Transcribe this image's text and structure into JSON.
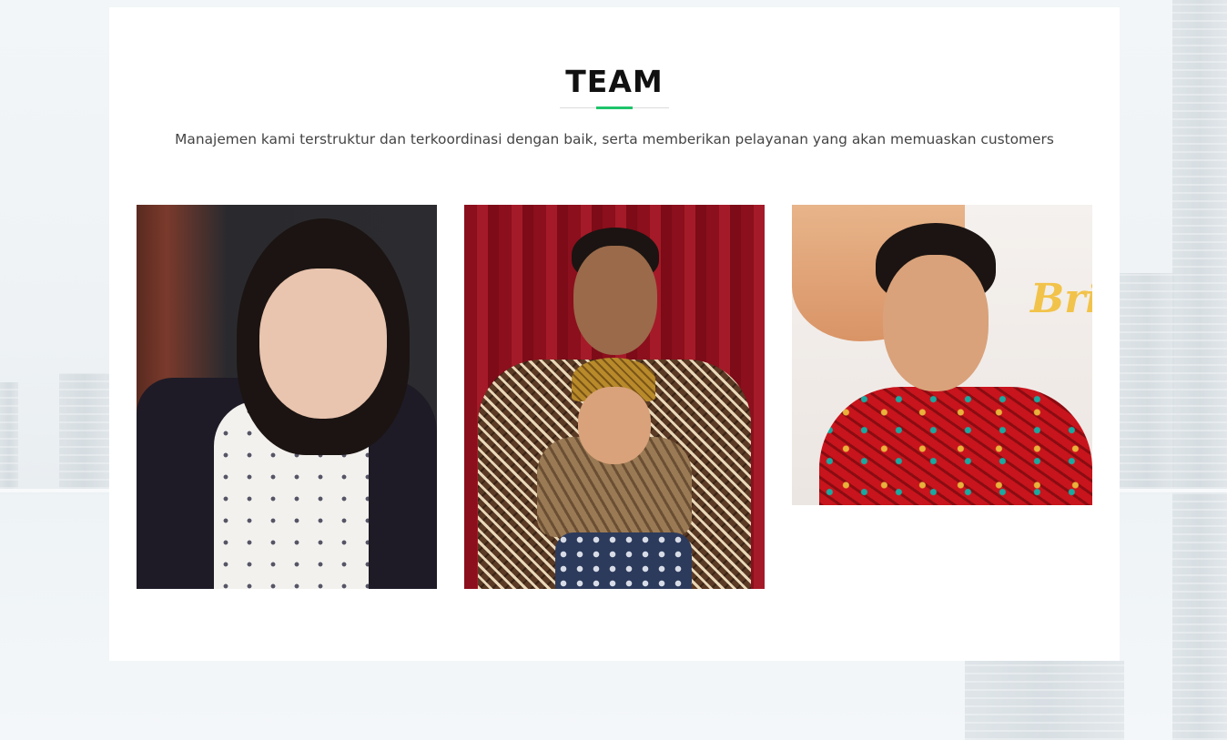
{
  "section": {
    "title": "TEAM",
    "subtitle": "Manajemen kami terstruktur dan terkoordinasi dengan baik, serta memberikan pelayanan yang akan memuaskan customers",
    "accent_color": "#1ec46a"
  },
  "team": [
    {
      "photo_icon": "woman-portrait-photo"
    },
    {
      "photo_icon": "man-holding-baby-photo"
    },
    {
      "photo_icon": "man-batik-shirt-photo"
    }
  ],
  "photo3": {
    "deco_text": "Bri"
  }
}
